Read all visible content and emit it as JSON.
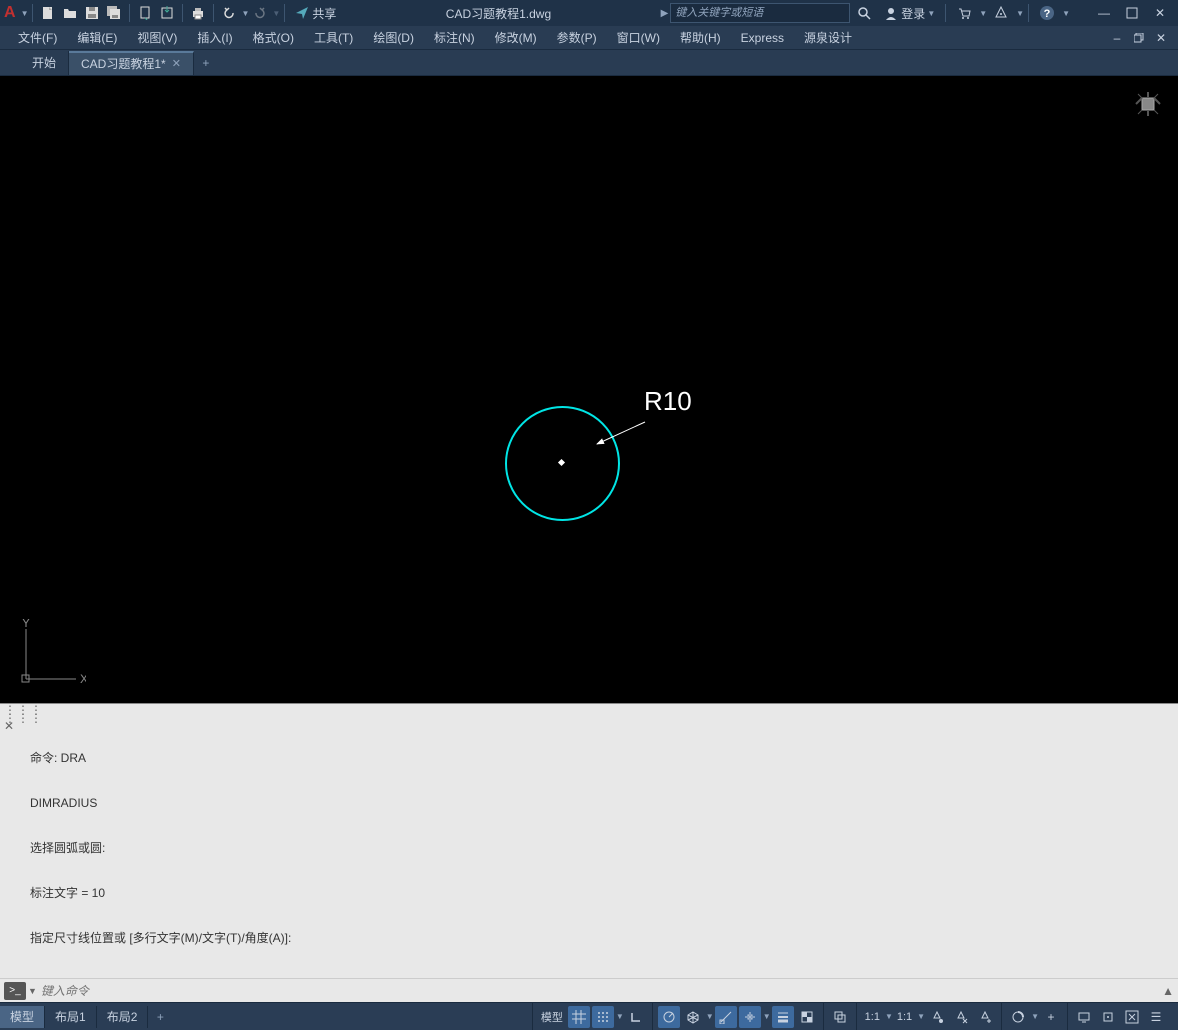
{
  "titlebar": {
    "share_label": "共享",
    "document_title": "CAD习题教程1.dwg",
    "search_placeholder": "键入关键字或短语",
    "login_label": "登录"
  },
  "menubar": {
    "items": [
      {
        "label": "文件(F)"
      },
      {
        "label": "编辑(E)"
      },
      {
        "label": "视图(V)"
      },
      {
        "label": "插入(I)"
      },
      {
        "label": "格式(O)"
      },
      {
        "label": "工具(T)"
      },
      {
        "label": "绘图(D)"
      },
      {
        "label": "标注(N)"
      },
      {
        "label": "修改(M)"
      },
      {
        "label": "参数(P)"
      },
      {
        "label": "窗口(W)"
      },
      {
        "label": "帮助(H)"
      },
      {
        "label": "Express"
      },
      {
        "label": "源泉设计"
      }
    ]
  },
  "doc_tabs": {
    "items": [
      {
        "label": "开始",
        "active": false,
        "closable": false
      },
      {
        "label": "CAD习题教程1*",
        "active": true,
        "closable": true
      }
    ]
  },
  "canvas": {
    "dimension_text": "R10",
    "ucs_x": "X",
    "ucs_y": "Y"
  },
  "command": {
    "history_lines": [
      "命令: DRA",
      "DIMRADIUS",
      "选择圆弧或圆:",
      "标注文字 = 10",
      "指定尺寸线位置或 [多行文字(M)/文字(T)/角度(A)]:"
    ],
    "input_placeholder": "键入命令"
  },
  "layout_tabs": {
    "items": [
      {
        "label": "模型",
        "active": true
      },
      {
        "label": "布局1",
        "active": false
      },
      {
        "label": "布局2",
        "active": false
      }
    ]
  },
  "status": {
    "model_label": "模型",
    "scale": "1:1",
    "scale_alt": "1:1"
  }
}
